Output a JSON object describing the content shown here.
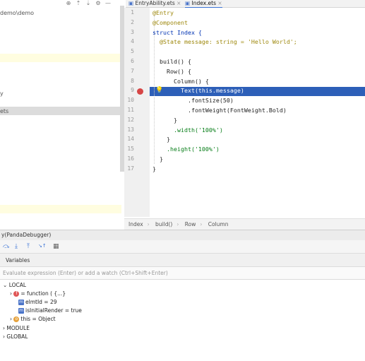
{
  "project": {
    "path": "demo\\demo",
    "selected_item": "ets",
    "item_y": "y"
  },
  "toolbar_icons": [
    "target-icon",
    "collapse-icon",
    "expand-icon",
    "gear-icon",
    "minimize-icon"
  ],
  "tabs": [
    {
      "label": "EntryAbility.ets",
      "active": false
    },
    {
      "label": "Index.ets",
      "active": true
    }
  ],
  "editor": {
    "lines": [
      {
        "n": "1",
        "text": "@Entry"
      },
      {
        "n": "2",
        "text": "@Component"
      },
      {
        "n": "3",
        "text": "struct Index {"
      },
      {
        "n": "4",
        "text": "  @State message: string = 'Hello World';"
      },
      {
        "n": "5",
        "text": ""
      },
      {
        "n": "6",
        "text": "  build() {"
      },
      {
        "n": "7",
        "text": "    Row() {"
      },
      {
        "n": "8",
        "text": "      Column() {"
      },
      {
        "n": "9",
        "text": "        Text(this.message)"
      },
      {
        "n": "10",
        "text": "          .fontSize(50)"
      },
      {
        "n": "11",
        "text": "          .fontWeight(FontWeight.Bold)"
      },
      {
        "n": "12",
        "text": "      }"
      },
      {
        "n": "13",
        "text": "      .width('100%')"
      },
      {
        "n": "14",
        "text": "    }"
      },
      {
        "n": "15",
        "text": "    .height('100%')"
      },
      {
        "n": "16",
        "text": "  }"
      },
      {
        "n": "17",
        "text": "}"
      }
    ],
    "breakpoint_line": "9"
  },
  "breadcrumbs": [
    "Index",
    "build()",
    "Row",
    "Column"
  ],
  "debugger": {
    "title": "y(PandaDebugger)",
    "variables_label": "Variables",
    "eval_placeholder": "Evaluate expression (Enter) or add a watch (Ctrl+Shift+Enter)",
    "tree": {
      "local": "LOCAL",
      "items": [
        {
          "name": "= function ( {...}",
          "icon": "red"
        },
        {
          "name": "elmtId = 29",
          "icon": "blue"
        },
        {
          "name": "isInitialRender = true",
          "icon": "blue"
        },
        {
          "name": "this = Object",
          "icon": "orange"
        }
      ],
      "module": "MODULE",
      "global": "GLOBAL"
    }
  },
  "colors": {
    "accent": "#3b73d6",
    "selection": "#2d5fb8",
    "keyword": "#0033b3",
    "annotation": "#9e880d",
    "string": "#067d17",
    "highlight": "#fffde0"
  }
}
